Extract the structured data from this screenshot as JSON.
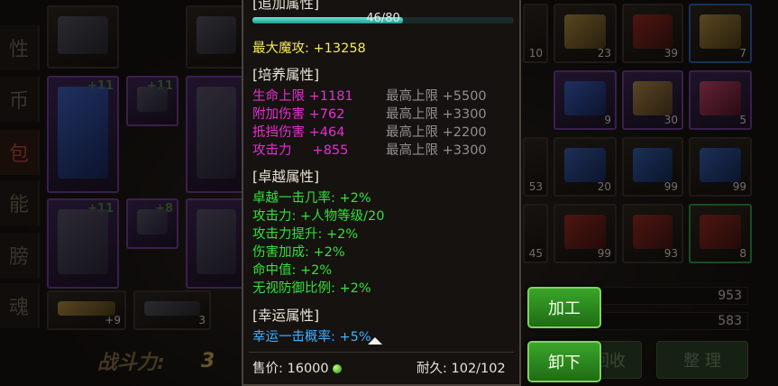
{
  "left_tabs": [
    "性",
    "币",
    "包",
    "能",
    "膀",
    "魂"
  ],
  "active_tab_index": 2,
  "inventory_counts": [
    "23",
    "39",
    "7",
    "10",
    "9",
    "30",
    "5",
    "53",
    "20",
    "99",
    "99",
    "45",
    "99",
    "93",
    "8"
  ],
  "equip_levels": [
    "+11",
    "+11",
    "+11",
    "+8"
  ],
  "bottom_counts": [
    "+9",
    "3"
  ],
  "power_label": "战斗力:",
  "power_value": "3",
  "stat_values": [
    "953",
    "583"
  ],
  "buttons": {
    "enhance": "加工",
    "unequip": "卸下",
    "recycle": "回收",
    "sort": "整 理"
  },
  "tooltip": {
    "top_header": "[追加属性]",
    "progress": {
      "text": "46/80",
      "current": 46,
      "max": 80
    },
    "max_magic_attack": "最大魔攻: +13258",
    "cultivate": {
      "header": "[培养属性]",
      "rows": [
        {
          "name": "生命上限 +1181",
          "max": "最高上限 +5500"
        },
        {
          "name": "附加伤害 +762",
          "max": "最高上限 +3300"
        },
        {
          "name": "抵挡伤害 +464",
          "max": "最高上限 +2200"
        },
        {
          "name": "攻击力     +855",
          "max": "最高上限 +3300"
        }
      ]
    },
    "excellent": {
      "header": "[卓越属性]",
      "rows": [
        "卓越一击几率: +2%",
        "攻击力: +人物等级/20",
        "攻击力提升: +2%",
        "伤害加成: +2%",
        "命中值: +2%",
        "无视防御比例: +2%"
      ]
    },
    "luck": {
      "header": "[幸运属性]",
      "rows": [
        "幸运一击概率: +5%"
      ]
    },
    "price": "售价: 16000",
    "durability": "耐久: 102/102"
  },
  "colors": {
    "cultivate": "#e62ed1",
    "excellent": "#34e03a",
    "luck": "#3fb0ff",
    "max_attack": "#f5ea53"
  }
}
